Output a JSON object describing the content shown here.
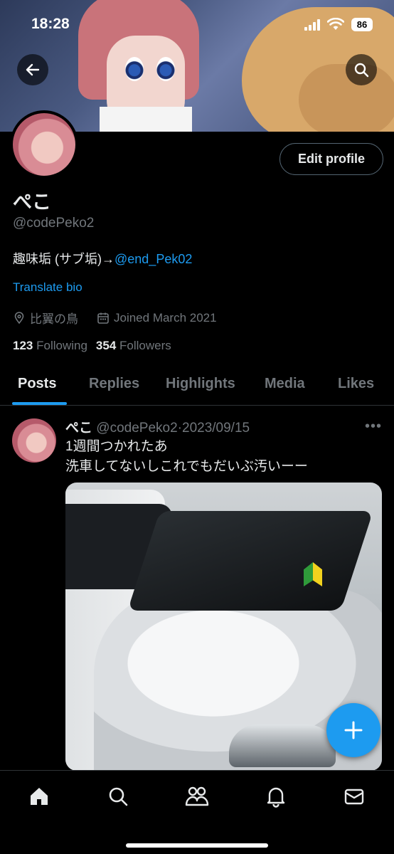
{
  "status_bar": {
    "time": "18:28",
    "battery": "86"
  },
  "profile": {
    "name": "ぺこ",
    "handle": "@codePeko2",
    "bio_text": "趣味垢 (サブ垢)→",
    "bio_mention": "@end_Pek02",
    "translate_label": "Translate bio",
    "location": "比翼の鳥",
    "joined": "Joined March 2021",
    "following_count": "123",
    "following_label": "Following",
    "followers_count": "354",
    "followers_label": "Followers",
    "edit_label": "Edit profile"
  },
  "tabs": [
    "Posts",
    "Replies",
    "Highlights",
    "Media",
    "Likes"
  ],
  "post": {
    "name": "ぺこ",
    "handle": "@codePeko2",
    "separator": "·",
    "date": "2023/09/15",
    "more": "•••",
    "line1": "1週間つかれたあ",
    "line2": "洗車してないしこれでもだいぶ汚いーー"
  },
  "colors": {
    "accent": "#1d9bf0",
    "muted": "#71767b",
    "text": "#e7e9ea",
    "bg": "#000000"
  },
  "icons": [
    "back-arrow-icon",
    "search-icon",
    "location-pin-icon",
    "calendar-icon",
    "plus-icon",
    "home-icon",
    "explore-search-icon",
    "communities-icon",
    "notifications-bell-icon",
    "messages-mail-icon"
  ]
}
